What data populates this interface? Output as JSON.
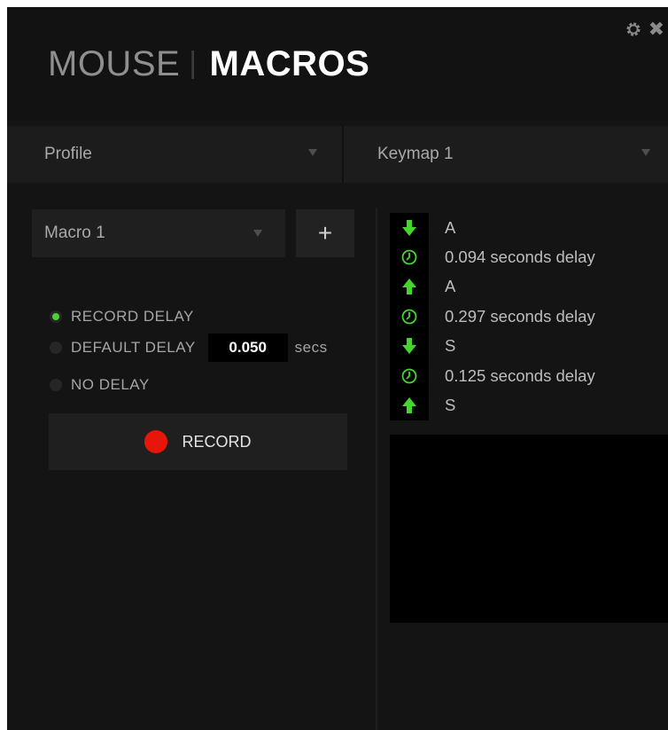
{
  "header": {
    "title_mouse": "MOUSE",
    "title_separator": "|",
    "title_macros": "MACROS",
    "icons": {
      "settings": "gear-icon",
      "close": "close-icon"
    },
    "close_glyph": "✖"
  },
  "dropdowns": {
    "profile": {
      "label": "Profile"
    },
    "keymap": {
      "label": "Keymap 1"
    }
  },
  "macro": {
    "selected": "Macro 1",
    "add_label": "+"
  },
  "delay_options": {
    "record_delay": {
      "label": "RECORD DELAY",
      "selected": true
    },
    "default_delay": {
      "label": "DEFAULT DELAY",
      "value": "0.050",
      "unit": "secs",
      "selected": false
    },
    "no_delay": {
      "label": "NO DELAY",
      "selected": false
    }
  },
  "record_button": {
    "label": "RECORD"
  },
  "events": [
    {
      "type": "key-down",
      "icon": "arrow-down-icon",
      "text": "A"
    },
    {
      "type": "delay",
      "icon": "clock-icon",
      "text": "0.094 seconds delay"
    },
    {
      "type": "key-up",
      "icon": "arrow-up-icon",
      "text": "A"
    },
    {
      "type": "delay",
      "icon": "clock-icon",
      "text": "0.297 seconds delay"
    },
    {
      "type": "key-down",
      "icon": "arrow-down-icon",
      "text": "S"
    },
    {
      "type": "delay",
      "icon": "clock-icon",
      "text": "0.125 seconds delay"
    },
    {
      "type": "key-up",
      "icon": "arrow-up-icon",
      "text": "S"
    }
  ],
  "colors": {
    "accent_green": "#44d62c",
    "record_red": "#e8150b",
    "background": "#141414",
    "panel": "#1f1f1f"
  }
}
